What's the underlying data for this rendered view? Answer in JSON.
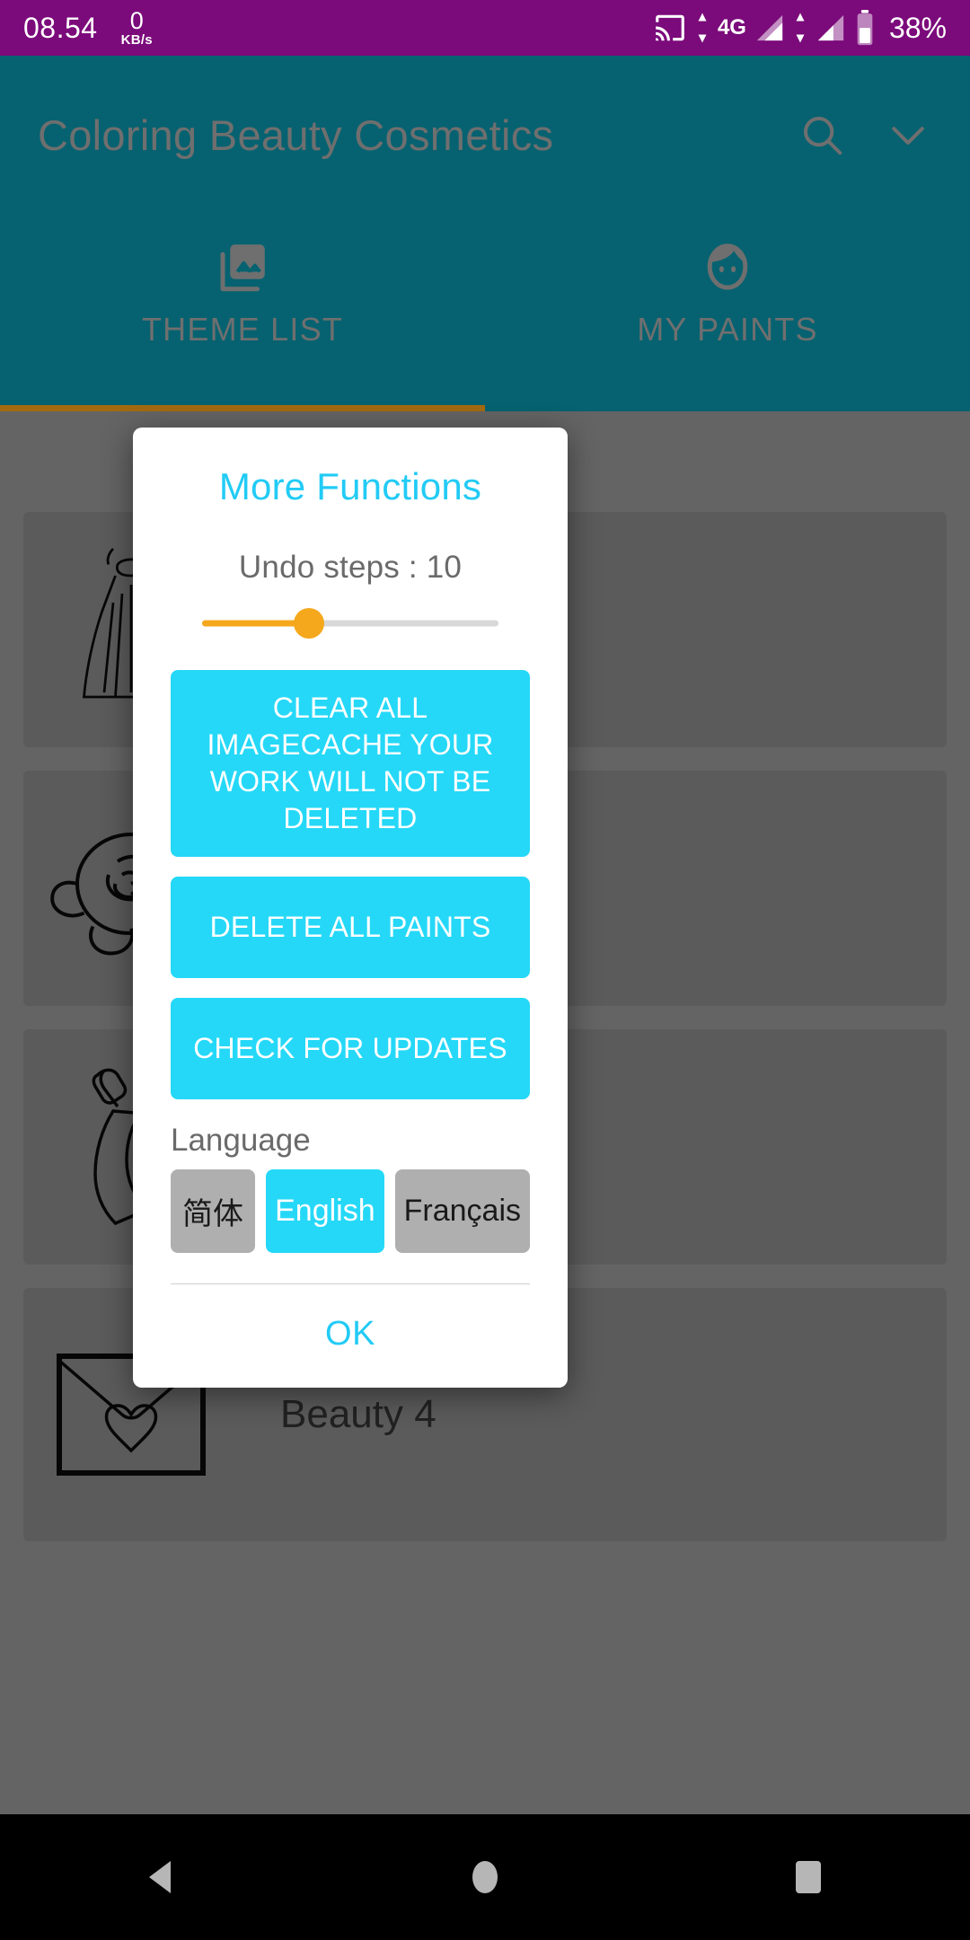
{
  "status_bar": {
    "time": "08.54",
    "net_speed_value": "0",
    "net_speed_unit": "KB/s",
    "cast_icon": "cast-icon",
    "network_type": "4G",
    "battery_percent": "38%",
    "background_color": "#7B0A7B"
  },
  "app_bar": {
    "title": "Coloring Beauty Cosmetics",
    "search_icon": "search-icon",
    "overflow_icon": "chevron-down-icon",
    "background_color": "#066270",
    "indicator_color": "#A36A10"
  },
  "tabs": [
    {
      "label": "THEME LIST",
      "icon": "collections-icon",
      "active": true
    },
    {
      "label": "MY PAINTS",
      "icon": "face-icon",
      "active": false
    }
  ],
  "content_list": [
    {
      "label": "",
      "thumb": "dress-icon"
    },
    {
      "label": "",
      "thumb": "rose-icon"
    },
    {
      "label": "",
      "thumb": "high-heel-icon"
    },
    {
      "label": "Beauty 4",
      "thumb": "envelope-heart-icon"
    }
  ],
  "dialog": {
    "title": "More Functions",
    "undo_label": "Undo steps : 10",
    "undo_value": 10,
    "slider_fill_color": "#F5A81C",
    "slider_track_color": "#D8D8D8",
    "accent_color": "#25D8F7",
    "buttons": [
      {
        "id": "clear-cache",
        "label": "CLEAR ALL IMAGECACHE YOUR WORK WILL NOT BE DELETED"
      },
      {
        "id": "delete-paints",
        "label": "DELETE ALL PAINTS"
      },
      {
        "id": "check-updates",
        "label": "CHECK FOR UPDATES"
      }
    ],
    "language_label": "Language",
    "languages": [
      {
        "label": "简体",
        "selected": false
      },
      {
        "label": "English",
        "selected": true
      },
      {
        "label": "Français",
        "selected": false
      }
    ],
    "ok_label": "OK"
  },
  "nav_bar": {
    "back_icon": "triangle-back-icon",
    "home_icon": "circle-home-icon",
    "recents_icon": "square-recents-icon"
  }
}
